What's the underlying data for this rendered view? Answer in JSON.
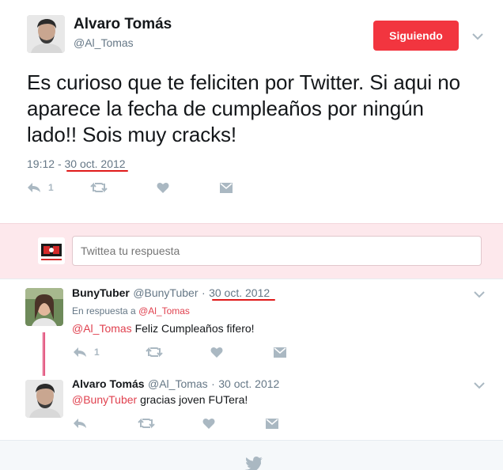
{
  "main_tweet": {
    "author_name": "Alvaro Tomás",
    "author_handle": "@Al_Tomas",
    "follow_label": "Siguiendo",
    "text": "Es curioso que te feliciten por Twitter. Si aqui no aparece la fecha de cumpleaños por ningún lado!! Sois muy cracks!",
    "time": "19:12",
    "separator": "-",
    "date": "30 oct. 2012",
    "reply_count": "1",
    "colors": {
      "follow": "#f2353f",
      "underline": "#e01a1a",
      "mention": "#e0414f"
    }
  },
  "reply_bar": {
    "placeholder": "Twittea tu respuesta"
  },
  "replies": [
    {
      "name": "BunyTuber",
      "handle": "@BunyTuber",
      "dot": "·",
      "date": "30 oct. 2012",
      "in_reply_prefix": "En respuesta a",
      "in_reply_handle": "@Al_Tomas",
      "mention": "@Al_Tomas",
      "text": "Feliz Cumpleaños fifero!",
      "reply_count": "1"
    },
    {
      "name": "Alvaro Tomás",
      "handle": "@Al_Tomas",
      "dot": "·",
      "date": "30 oct. 2012",
      "mention": "@BunyTuber",
      "text": "gracias joven FUTera!"
    }
  ],
  "icons": [
    "reply-icon",
    "retweet-icon",
    "heart-icon",
    "dm-icon",
    "chevron-down-icon",
    "twitter-bird-icon"
  ]
}
